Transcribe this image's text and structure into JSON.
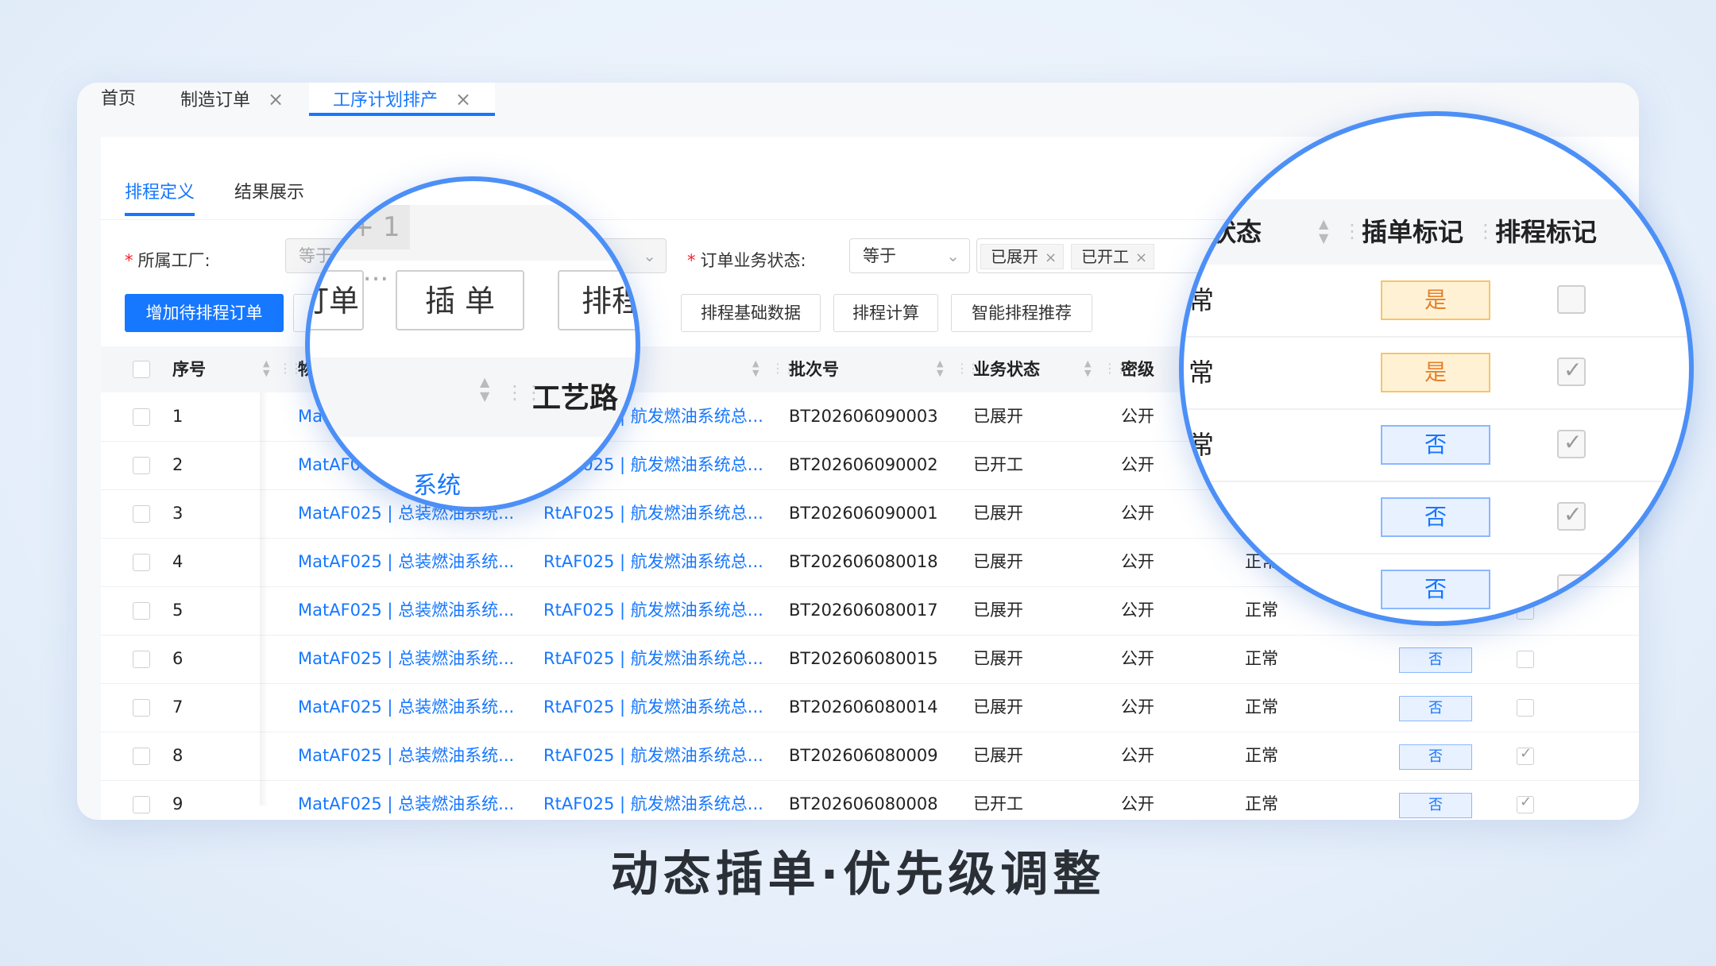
{
  "window_tabs": [
    {
      "label": "首页",
      "closable": false,
      "active": false
    },
    {
      "label": "制造订单",
      "closable": true,
      "active": false
    },
    {
      "label": "工序计划排产",
      "closable": true,
      "active": true
    }
  ],
  "close_glyph": "×",
  "sub_tabs": [
    {
      "label": "排程定义",
      "active": true
    },
    {
      "label": "结果展示",
      "active": false
    }
  ],
  "filters": {
    "factory": {
      "label": "所属工厂:",
      "value": "等于"
    },
    "order_status": {
      "label": "订单业务状态:",
      "operator": "等于",
      "tags": [
        "已展开",
        "已开工"
      ]
    }
  },
  "toolbar": {
    "add_pending": "增加待排程订单",
    "basic_data": "排程基础数据",
    "calculate": "排程计算",
    "smart_recommend": "智能排程推荐"
  },
  "table": {
    "columns": {
      "seq": "序号",
      "material": "物",
      "batch": "批次号",
      "biz_status": "业务状态",
      "secret": "密级"
    },
    "rows": [
      {
        "seq": "1",
        "material": "Ma",
        "route": "RtAF025 | 航发燃油系统总...",
        "batch": "BT202606090003",
        "biz_status": "已展开",
        "secret": "公开",
        "status": "",
        "insert": "",
        "checked": false
      },
      {
        "seq": "2",
        "material": "MatAF0",
        "route": "RtAF025 | 航发燃油系统总...",
        "batch": "BT202606090002",
        "biz_status": "已开工",
        "secret": "公开",
        "status": "",
        "insert": "",
        "checked": false
      },
      {
        "seq": "3",
        "material": "MatAF025 | 总装燃油系统...",
        "route": "RtAF025 | 航发燃油系统总...",
        "batch": "BT202606090001",
        "biz_status": "已展开",
        "secret": "公开",
        "status": "",
        "insert": "",
        "checked": false
      },
      {
        "seq": "4",
        "material": "MatAF025 | 总装燃油系统...",
        "route": "RtAF025 | 航发燃油系统总...",
        "batch": "BT202606080018",
        "biz_status": "已展开",
        "secret": "公开",
        "status": "正常",
        "insert": "",
        "checked": false
      },
      {
        "seq": "5",
        "material": "MatAF025 | 总装燃油系统...",
        "route": "RtAF025 | 航发燃油系统总...",
        "batch": "BT202606080017",
        "biz_status": "已展开",
        "secret": "公开",
        "status": "正常",
        "insert": "",
        "checked": true
      },
      {
        "seq": "6",
        "material": "MatAF025 | 总装燃油系统...",
        "route": "RtAF025 | 航发燃油系统总...",
        "batch": "BT202606080015",
        "biz_status": "已展开",
        "secret": "公开",
        "status": "正常",
        "insert": "否",
        "checked": false
      },
      {
        "seq": "7",
        "material": "MatAF025 | 总装燃油系统...",
        "route": "RtAF025 | 航发燃油系统总...",
        "batch": "BT202606080014",
        "biz_status": "已展开",
        "secret": "公开",
        "status": "正常",
        "insert": "否",
        "checked": false
      },
      {
        "seq": "8",
        "material": "MatAF025 | 总装燃油系统...",
        "route": "RtAF025 | 航发燃油系统总...",
        "batch": "BT202606080009",
        "biz_status": "已展开",
        "secret": "公开",
        "status": "正常",
        "insert": "否",
        "checked": true
      },
      {
        "seq": "9",
        "material": "MatAF025 | 总装燃油系统...",
        "route": "RtAF025 | 航发燃油系统总...",
        "batch": "BT202606080008",
        "biz_status": "已开工",
        "secret": "公开",
        "status": "正常",
        "insert": "否",
        "checked": true
      }
    ]
  },
  "magnifier_left": {
    "factory_overflow": "+ 1 ...",
    "btn_order": "订单",
    "btn_insert": "插 单",
    "btn_schedule": "排程",
    "col_route": "工艺路",
    "row_fragment": "系统"
  },
  "magnifier_right": {
    "col_status": "状态",
    "col_insert_mark": "插单标记",
    "col_schedule_mark": "排程标记",
    "rows": [
      {
        "status": "常",
        "insert": "是",
        "checked": false
      },
      {
        "status": "常",
        "insert": "是",
        "checked": true
      },
      {
        "status": "常",
        "insert": "否",
        "checked": true
      },
      {
        "status": "",
        "insert": "否",
        "checked": true
      },
      {
        "status": "",
        "insert": "否",
        "checked": false
      }
    ]
  },
  "caption": "动态插单·优先级调整",
  "colors": {
    "accent": "#1677ff",
    "magnifier_ring": "#4c8ff7",
    "insert_yes_bg": "#fff2d4",
    "insert_no_bg": "#e8f1ff"
  }
}
